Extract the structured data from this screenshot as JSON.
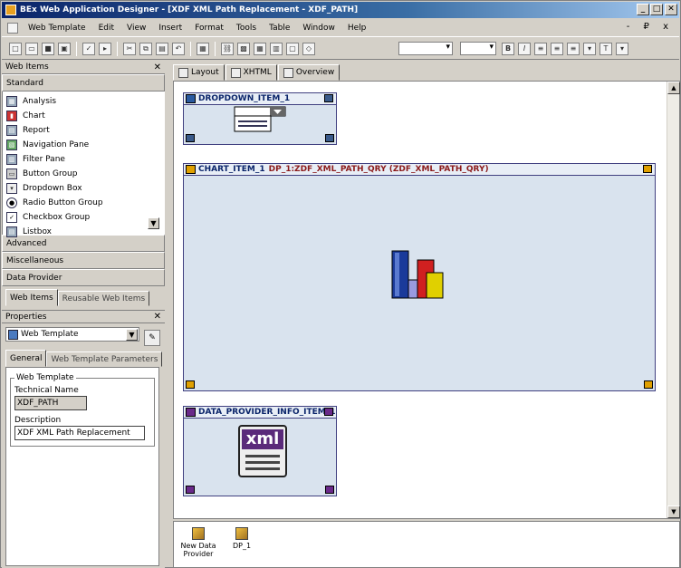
{
  "window": {
    "title": "BEx Web Application Designer - [XDF XML Path Replacement - XDF_PATH]",
    "controls": [
      "_",
      "□",
      "✕"
    ]
  },
  "menu": {
    "items": [
      "Web Template",
      "Edit",
      "View",
      "Insert",
      "Format",
      "Tools",
      "Table",
      "Window",
      "Help"
    ],
    "mdi_controls": "- ₽ x"
  },
  "web_items": {
    "title": "Web Items",
    "close": "✕",
    "sections": {
      "standard": "Standard",
      "advanced": "Advanced",
      "misc": "Miscellaneous",
      "data_provider": "Data Provider"
    },
    "standard_items": [
      {
        "label": "Analysis",
        "icon": "table-icon"
      },
      {
        "label": "Chart",
        "icon": "chart-icon"
      },
      {
        "label": "Report",
        "icon": "report-icon"
      },
      {
        "label": "Navigation Pane",
        "icon": "navigation-icon"
      },
      {
        "label": "Filter Pane",
        "icon": "filter-icon"
      },
      {
        "label": "Button Group",
        "icon": "button-group-icon"
      },
      {
        "label": "Dropdown Box",
        "icon": "dropdown-icon"
      },
      {
        "label": "Radio Button Group",
        "icon": "radio-icon"
      },
      {
        "label": "Checkbox Group",
        "icon": "checkbox-icon"
      },
      {
        "label": "Listbox",
        "icon": "listbox-icon"
      }
    ],
    "tabs": [
      "Web Items",
      "Reusable Web Items"
    ]
  },
  "properties": {
    "title": "Properties",
    "close": "✕",
    "selected": "Web Template",
    "tabs": [
      "General",
      "Web Template Parameters"
    ],
    "group_label": "Web Template",
    "technical_name_label": "Technical Name",
    "technical_name": "XDF_PATH",
    "description_label": "Description",
    "description": "XDF XML Path Replacement"
  },
  "doc_tabs": [
    "Layout",
    "XHTML",
    "Overview"
  ],
  "items": {
    "dropdown": {
      "name": "DROPDOWN_ITEM_1"
    },
    "chart": {
      "name": "CHART_ITEM_1",
      "data_provider": "DP_1:ZDF_XML_PATH_QRY (ZDF_XML_PATH_QRY)"
    },
    "dp_info": {
      "name": "DATA_PROVIDER_INFO_ITEM_1",
      "xml_label": "xml"
    }
  },
  "data_providers": [
    {
      "label": "New Data Provider"
    },
    {
      "label": "DP_1"
    }
  ]
}
